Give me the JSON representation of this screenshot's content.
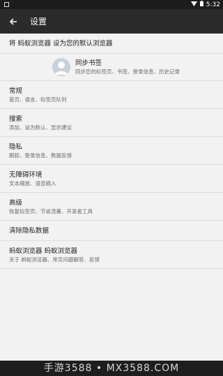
{
  "status_bar": {
    "time": "5:32"
  },
  "app_bar": {
    "title": "设置"
  },
  "default_browser": {
    "label": "将 蚂蚁浏览器 设为您的默认浏览器"
  },
  "sync": {
    "title": "同步书签",
    "subtitle": "同步您的标签页、书签、登录信息、历史记录"
  },
  "sections": [
    {
      "title": "常规",
      "subtitle": "首页、语言、标签页队列"
    },
    {
      "title": "搜索",
      "subtitle": "添加、设为默认、显示建议"
    },
    {
      "title": "隐私",
      "subtitle": "跟踪、登录信息、数据反馈"
    },
    {
      "title": "无障碍环境",
      "subtitle": "文本缩放、语音输入"
    },
    {
      "title": "高级",
      "subtitle": "恢复标签页、节省流量、开发者工具"
    }
  ],
  "clear_data": {
    "label": "清除隐私数据"
  },
  "about": {
    "title": "蚂蚁浏览器 蚂蚁浏览器",
    "subtitle": "关于 蚂蚁浏览器、常见问题解答、反馈"
  },
  "watermark": {
    "text": "手游3588 • MX3588.COM"
  }
}
